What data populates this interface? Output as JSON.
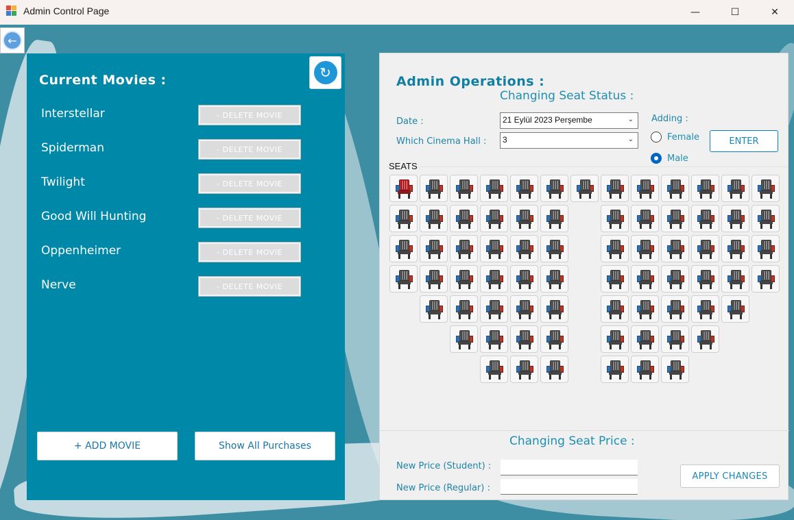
{
  "window": {
    "title": "Admin Control Page",
    "minimize_glyph": "—",
    "maximize_glyph": "☐",
    "close_glyph": "✕"
  },
  "icons": {
    "back": "arrow-left-icon",
    "refresh": "refresh-icon",
    "app": "app-window-icon"
  },
  "left": {
    "title": "Current Movies :",
    "movies": [
      {
        "name": "Interstellar",
        "delete_label": "- DELETE MOVIE"
      },
      {
        "name": "Spiderman",
        "delete_label": "- DELETE MOVIE"
      },
      {
        "name": "Twilight",
        "delete_label": "- DELETE MOVIE"
      },
      {
        "name": "Good Will Hunting",
        "delete_label": "- DELETE MOVIE"
      },
      {
        "name": "Oppenheimer",
        "delete_label": "- DELETE MOVIE"
      },
      {
        "name": "Nerve",
        "delete_label": "- DELETE MOVIE"
      }
    ],
    "add_label": "+ ADD MOVIE",
    "purchases_label": "Show All Purchases"
  },
  "right": {
    "title": "Admin Operations :",
    "seat_status_title": "Changing Seat Status :",
    "date_label": "Date :",
    "date_value": "21    Eylül    2023 Perşembe",
    "hall_label": "Which Cinema Hall :",
    "hall_value": "3",
    "adding_label": "Adding :",
    "female_label": "Female",
    "male_label": "Male",
    "selected_gender": "Male",
    "enter_label": "ENTER",
    "seats_label": "SEATS",
    "seat_rows": [
      [
        1,
        1,
        1,
        1,
        1,
        1,
        1,
        1,
        1,
        1,
        1,
        1,
        1
      ],
      [
        1,
        1,
        1,
        1,
        1,
        1,
        0,
        1,
        1,
        1,
        1,
        1,
        1
      ],
      [
        1,
        1,
        1,
        1,
        1,
        1,
        0,
        1,
        1,
        1,
        1,
        1,
        1
      ],
      [
        1,
        1,
        1,
        1,
        1,
        1,
        0,
        1,
        1,
        1,
        1,
        1,
        1
      ],
      [
        0,
        1,
        1,
        1,
        1,
        1,
        0,
        1,
        1,
        1,
        1,
        1,
        0
      ],
      [
        0,
        0,
        1,
        1,
        1,
        1,
        0,
        1,
        1,
        1,
        1,
        0,
        0
      ],
      [
        0,
        0,
        0,
        1,
        1,
        1,
        0,
        1,
        1,
        1,
        0,
        0,
        0
      ]
    ],
    "taken_seats": [
      [
        0,
        0
      ]
    ],
    "price_title": "Changing Seat Price :",
    "student_label": "New Price (Student) :",
    "regular_label": "New Price (Regular) :",
    "student_value": "",
    "regular_value": "",
    "apply_label": "APPLY CHANGES"
  },
  "colors": {
    "panel_teal": "#0088a8",
    "accent_blue": "#1d84a6",
    "taken_seat": "#c0272d"
  }
}
